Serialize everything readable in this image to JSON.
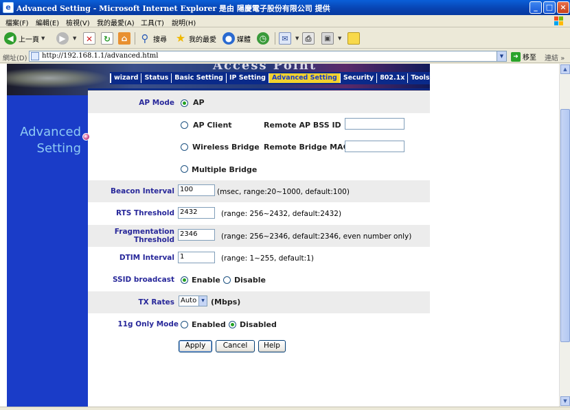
{
  "window": {
    "title": "Advanced Setting - Microsoft Internet Explorer 是由 陽慶電子股份有限公司 提供",
    "app_icon_glyph": "e",
    "minimize_glyph": "_",
    "maximize_glyph": "□",
    "close_glyph": "×"
  },
  "menubar": [
    "檔案(F)",
    "編輯(E)",
    "檢視(V)",
    "我的最愛(A)",
    "工具(T)",
    "說明(H)"
  ],
  "toolbar": {
    "back_label": "上一頁",
    "search_label": "搜尋",
    "favorites_label": "我的最愛",
    "media_label": "媒體"
  },
  "address": {
    "label": "網址(D)",
    "url": "http://192.168.1.1/advanced.html",
    "go_label": "移至",
    "links_label": "連結",
    "chevron": "»"
  },
  "colors": {
    "accent": "#1a3cc8",
    "nav_active": "#f2d22e",
    "label_blue": "#28289a",
    "band_gray": "#ececec",
    "side_title": "#8ecaf4"
  },
  "page": {
    "brand_partial": "Access Point",
    "nav": [
      "wizard",
      "Status",
      "Basic  Setting",
      "IP Setting",
      "Advanced Setting",
      "Security",
      "802.1x",
      "Tools"
    ],
    "nav_active_index": 4,
    "side_title_line1": "Advanced",
    "side_title_line2": "Setting"
  },
  "form": {
    "ap_mode": {
      "label": "AP Mode",
      "options": [
        "AP",
        "AP Client",
        "Wireless Bridge",
        "Multiple Bridge"
      ],
      "selected": "AP",
      "remote_ap_bssid_label": "Remote AP BSS ID",
      "remote_ap_bssid_value": "",
      "remote_bridge_mac_label": "Remote Bridge MAC",
      "remote_bridge_mac_value": ""
    },
    "beacon_interval": {
      "label": "Beacon Interval",
      "value": "100",
      "hint": "(msec, range:20~1000, default:100)"
    },
    "rts_threshold": {
      "label": "RTS Threshold",
      "value": "2432",
      "hint": "(range: 256~2432, default:2432)"
    },
    "fragmentation": {
      "label_line1": "Fragmentation",
      "label_line2": "Threshold",
      "value": "2346",
      "hint": "(range: 256~2346, default:2346, even number only)"
    },
    "dtim_interval": {
      "label": "DTIM Interval",
      "value": "1",
      "hint": "(range: 1~255, default:1)"
    },
    "ssid_broadcast": {
      "label": "SSID broadcast",
      "options": [
        "Enable",
        "Disable"
      ],
      "selected": "Enable"
    },
    "tx_rates": {
      "label": "TX Rates",
      "value": "Auto",
      "unit": "(Mbps)"
    },
    "only_11g": {
      "label": "11g Only Mode",
      "options": [
        "Enabled",
        "Disabled"
      ],
      "selected": "Disabled"
    },
    "buttons": {
      "apply": "Apply",
      "cancel": "Cancel",
      "help": "Help"
    }
  }
}
